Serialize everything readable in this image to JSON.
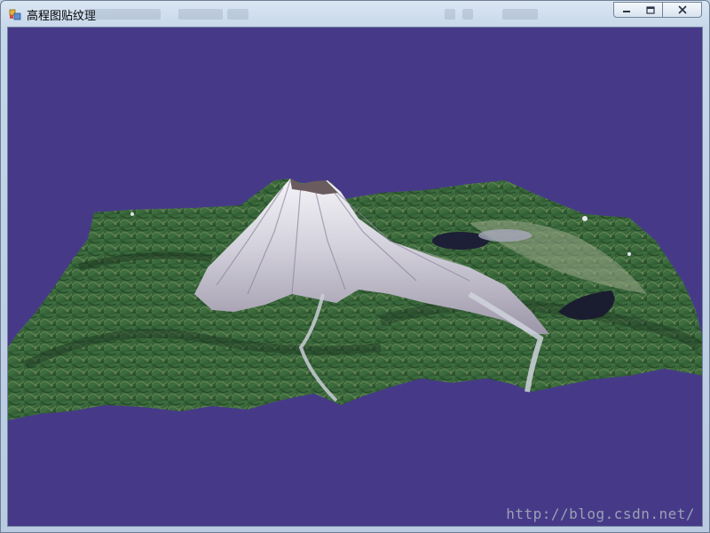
{
  "window": {
    "title": "高程图贴纹理",
    "icon": "app-window-icon",
    "controls": {
      "minimize": "minimize-icon",
      "maximize": "maximize-icon",
      "close": "close-icon"
    }
  },
  "viewport": {
    "background_color": "#463a88",
    "scene": "3D terrain rendered with satellite imagery texture, snow-capped volcano peak",
    "watermark": "http://blog.csdn.net/"
  }
}
